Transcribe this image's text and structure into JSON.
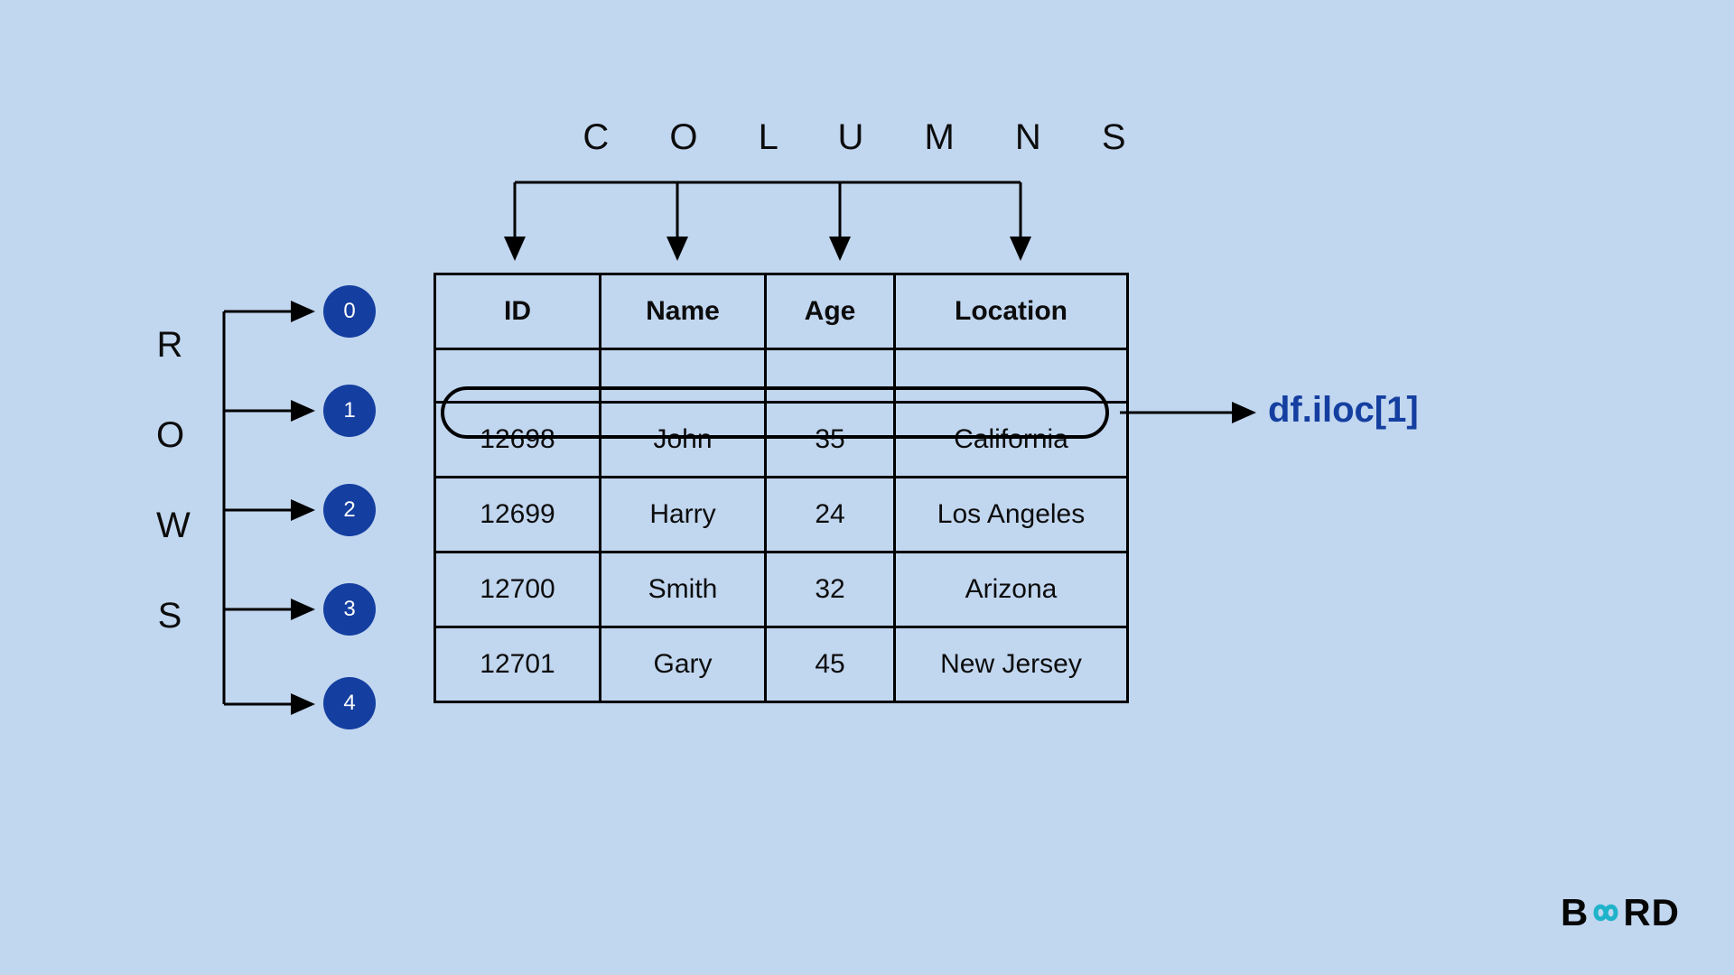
{
  "labels": {
    "columns": "C O L U M N S",
    "rows": [
      "R",
      "O",
      "W",
      "S"
    ],
    "iloc": "df.iloc[1]"
  },
  "row_indices": [
    "0",
    "1",
    "2",
    "3",
    "4"
  ],
  "table": {
    "headers": [
      "ID",
      "Name",
      "Age",
      "Location"
    ],
    "rows": [
      [
        "12698",
        "John",
        "35",
        "California"
      ],
      [
        "12699",
        "Harry",
        "24",
        "Los Angeles"
      ],
      [
        "12700",
        "Smith",
        "32",
        "Arizona"
      ],
      [
        "12701",
        "Gary",
        "45",
        "New Jersey"
      ]
    ]
  },
  "logo": {
    "left": "B",
    "right": "RD"
  }
}
